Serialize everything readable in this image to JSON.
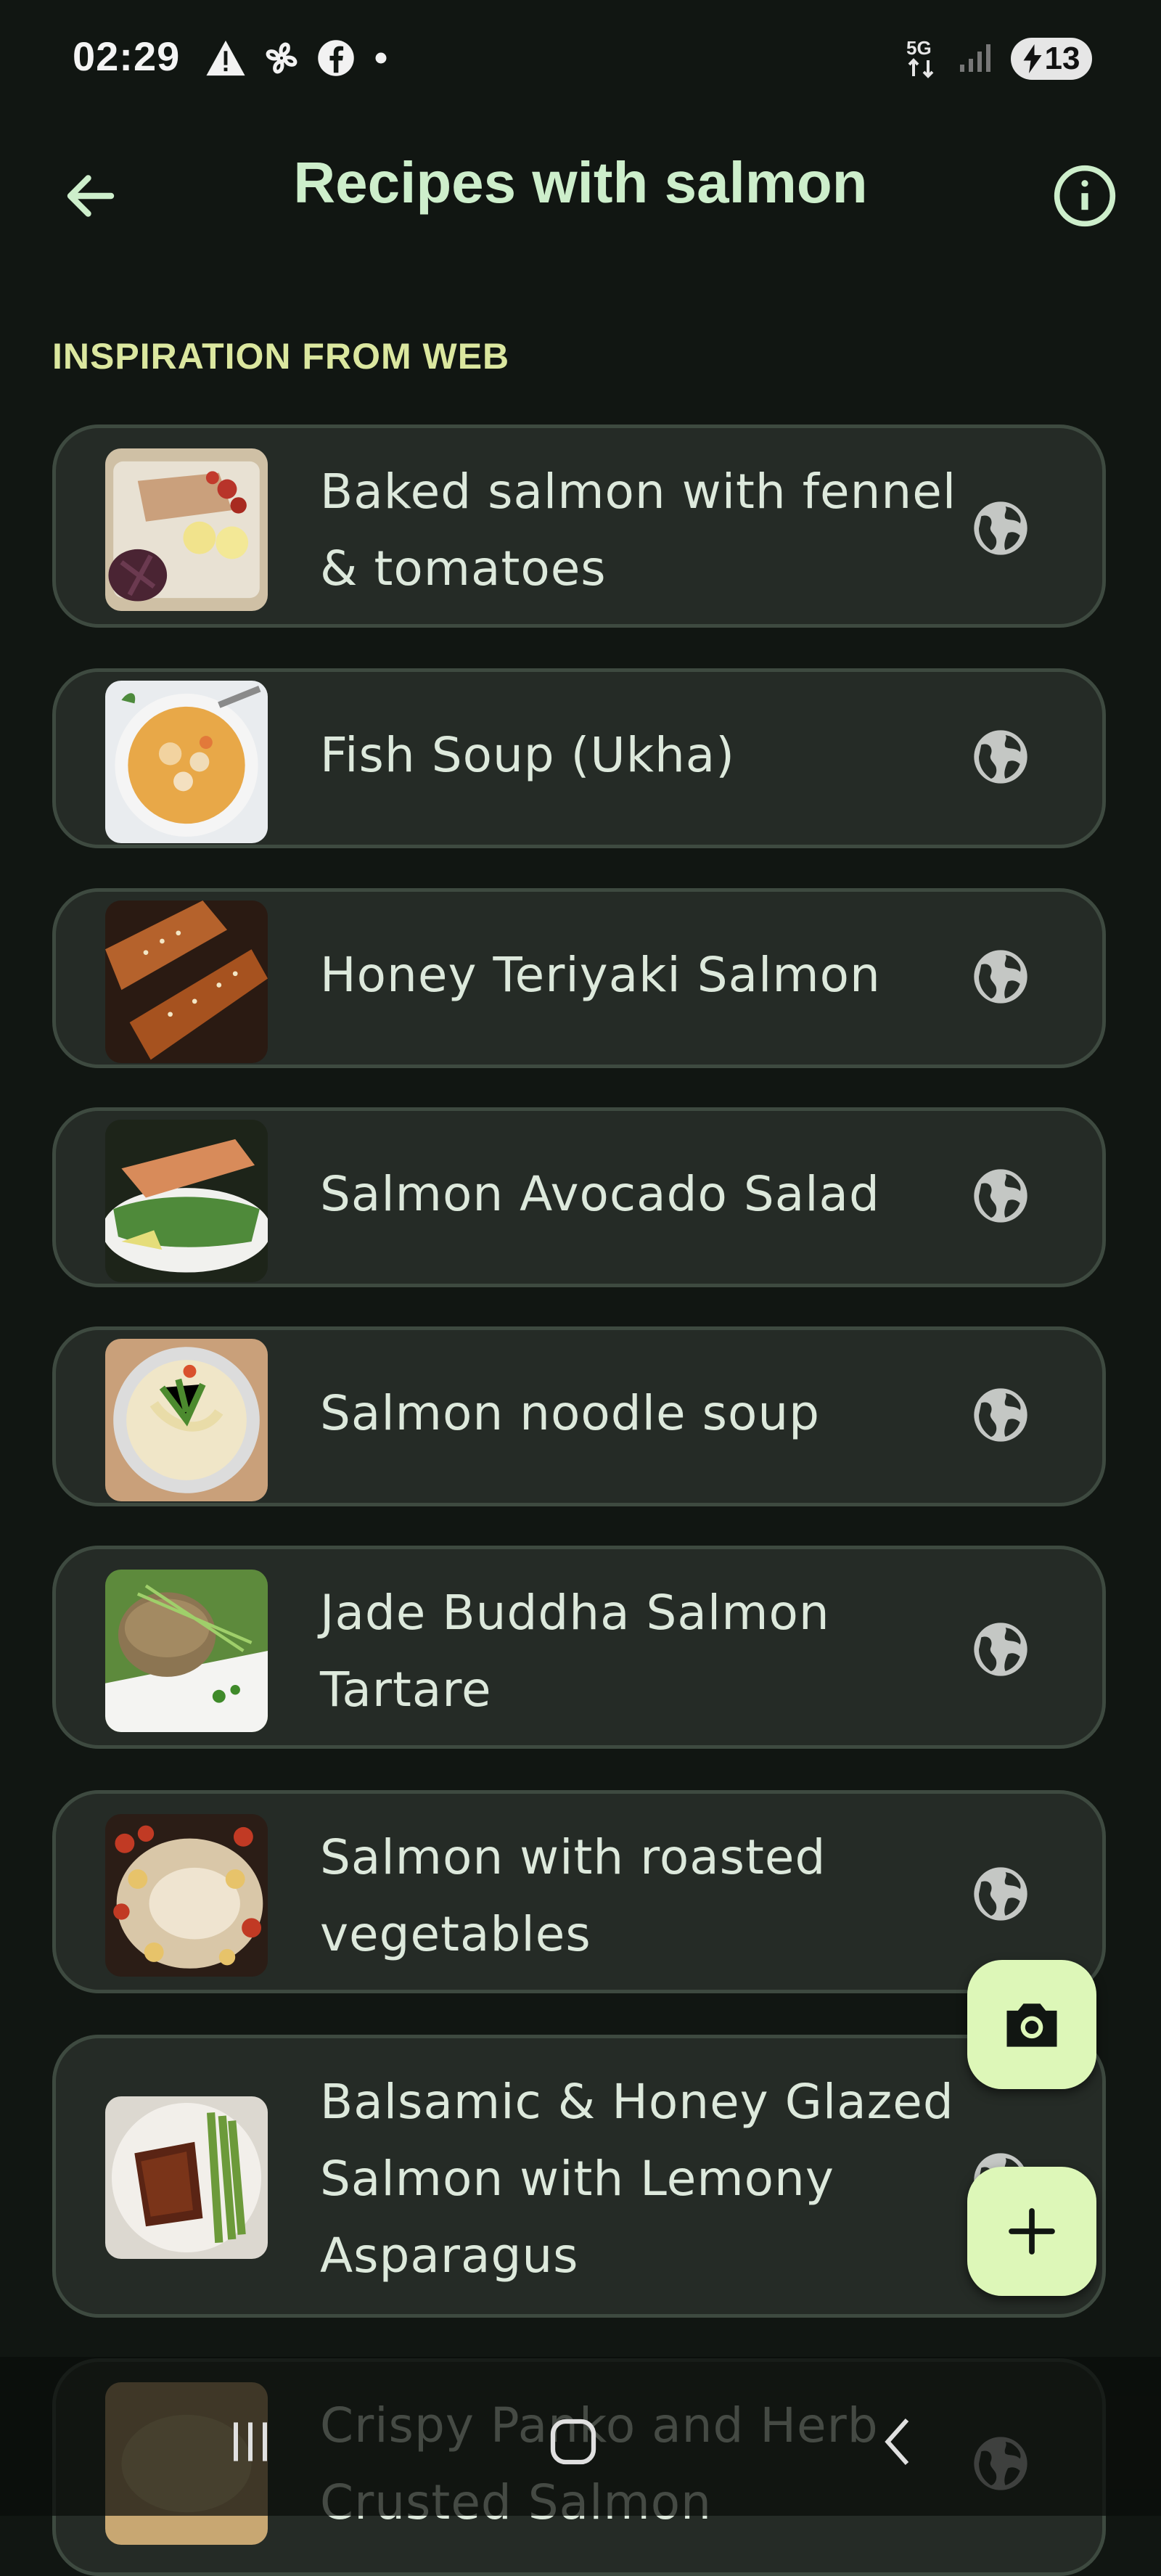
{
  "status_bar": {
    "time": "02:29",
    "battery": "13",
    "icons": [
      "warning-icon",
      "fan-icon",
      "facebook-icon",
      "dot-icon",
      "5g-icon",
      "signal-icon",
      "battery-charging-icon"
    ]
  },
  "app_bar": {
    "title": "Recipes with salmon",
    "back_icon": "arrow-left-icon",
    "info_icon": "info-icon"
  },
  "section_header": "INSPIRATION FROM WEB",
  "recipes": [
    {
      "title": "Baked salmon with fennel & tomatoes",
      "icon": "globe-icon"
    },
    {
      "title": "Fish Soup (Ukha)",
      "icon": "globe-icon"
    },
    {
      "title": "Honey Teriyaki Salmon",
      "icon": "globe-icon"
    },
    {
      "title": "Salmon Avocado Salad",
      "icon": "globe-icon"
    },
    {
      "title": "Salmon noodle soup",
      "icon": "globe-icon"
    },
    {
      "title": "Jade Buddha Salmon Tartare",
      "icon": "globe-icon"
    },
    {
      "title": "Salmon with roasted vegetables",
      "icon": "globe-icon"
    },
    {
      "title": "Balsamic & Honey Glazed Salmon with Lemony Asparagus",
      "icon": "globe-icon"
    },
    {
      "title": "Crispy Panko and Herb Crusted Salmon",
      "icon": "globe-icon"
    }
  ],
  "fabs": {
    "camera_icon": "camera-icon",
    "add_icon": "plus-icon"
  },
  "nav_bar": {
    "recents_icon": "recents-icon",
    "home_icon": "home-icon",
    "back_icon": "chevron-left-icon"
  },
  "colors": {
    "background": "#111612",
    "card": "#252b26",
    "card_border": "#3e4a40",
    "title": "#cdeecb",
    "section": "#dbe79f",
    "fab": "#ddf7b8"
  }
}
